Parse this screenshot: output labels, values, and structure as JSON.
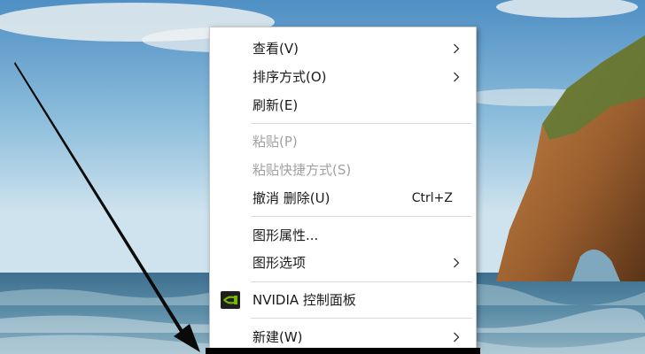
{
  "context_menu": {
    "items": [
      {
        "label": "查看(V)"
      },
      {
        "label": "排序方式(O)"
      },
      {
        "label": "刷新(E)"
      },
      {
        "label": "粘贴(P)"
      },
      {
        "label": "粘贴快捷方式(S)"
      },
      {
        "label": "撤消 删除(U)",
        "shortcut": "Ctrl+Z"
      },
      {
        "label": "图形属性..."
      },
      {
        "label": "图形选项"
      },
      {
        "label": "NVIDIA 控制面板"
      },
      {
        "label": "新建(W)"
      }
    ],
    "submenu_icon": "chevron-right-icon",
    "nvidia_icon": "nvidia-logo-icon"
  },
  "colors": {
    "menu_bg": "#ffffff",
    "separator": "#d9d9d9",
    "disabled_text": "#a0a0a0",
    "nvidia_green": "#76b900"
  }
}
